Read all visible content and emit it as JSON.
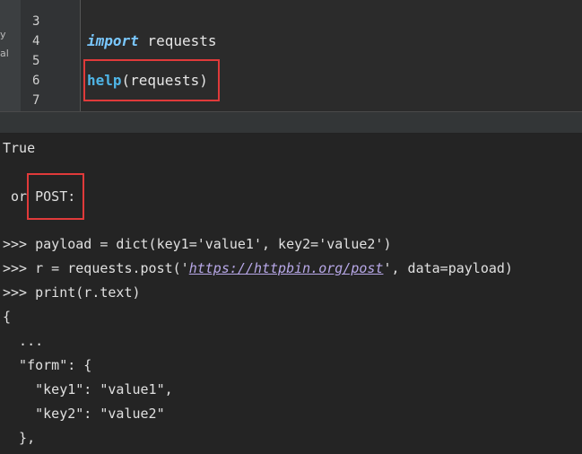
{
  "sidebar": {
    "fragments": [
      "y",
      "al"
    ]
  },
  "editor": {
    "line_numbers": [
      "3",
      "4",
      "5",
      "6",
      "7"
    ],
    "lines": {
      "import_kw": "import",
      "import_rest": " requests",
      "help_kw": "help",
      "help_rest": "(requests)"
    }
  },
  "console": {
    "true_output": "True",
    "or_text": " or ",
    "post_text": "POST:",
    "prompt": ">>>",
    "cmd1": " payload = dict(key1='value1', key2='value2')",
    "cmd2_pre": " r = requests.post('",
    "cmd2_url": "https://httpbin.org/post",
    "cmd2_post": "', data=payload)",
    "cmd3": " print(r.text)",
    "out1": "{",
    "out2": "  ...",
    "out3": "  \"form\": {",
    "out4": "    \"key1\": \"value1\",",
    "out5": "    \"key2\": \"value2\"",
    "out6": "  },"
  },
  "colors": {
    "highlight_border": "#e03a3a",
    "keyword": "#4fb5e6",
    "link": "#b8a8e8"
  }
}
